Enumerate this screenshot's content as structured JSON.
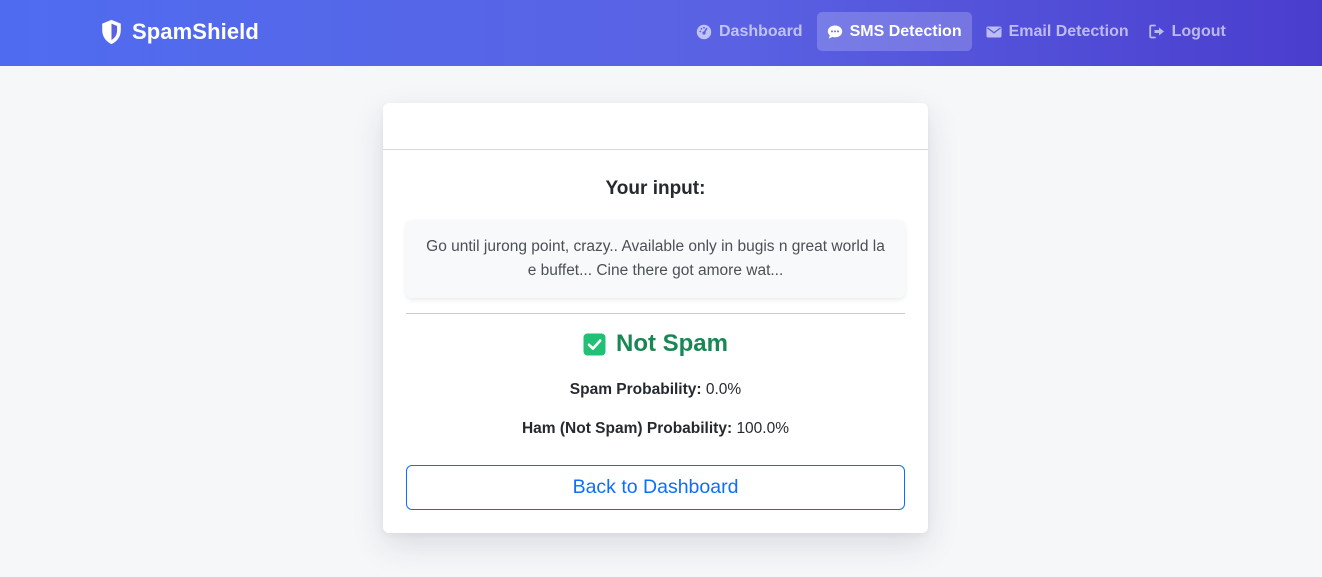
{
  "brand": {
    "name": "SpamShield",
    "icon": "shield-icon"
  },
  "nav": {
    "items": [
      {
        "label": "Dashboard",
        "icon": "gauge-icon",
        "active": false
      },
      {
        "label": "SMS Detection",
        "icon": "chat-bubble-icon",
        "active": true
      },
      {
        "label": "Email Detection",
        "icon": "envelope-icon",
        "active": false
      },
      {
        "label": "Logout",
        "icon": "logout-icon",
        "active": false
      }
    ]
  },
  "result_card": {
    "input_title": "Your input:",
    "input_text": "Go until jurong point, crazy.. Available only in bugis n great world la e buffet... Cine there got amore wat...",
    "result_label": "Not Spam",
    "result_icon": "check-square-icon",
    "spam_probability_label": "Spam Probability:",
    "spam_probability_value": "0.0%",
    "ham_probability_label": "Ham (Not Spam) Probability:",
    "ham_probability_value": "100.0%",
    "back_button_label": "Back to Dashboard"
  },
  "colors": {
    "nav_gradient_start": "#4f6cf0",
    "nav_gradient_end": "#4a3dce",
    "success": "#198754",
    "check_fill": "#20c075",
    "primary": "#0d6efd",
    "page_background": "#f6f7f9"
  }
}
